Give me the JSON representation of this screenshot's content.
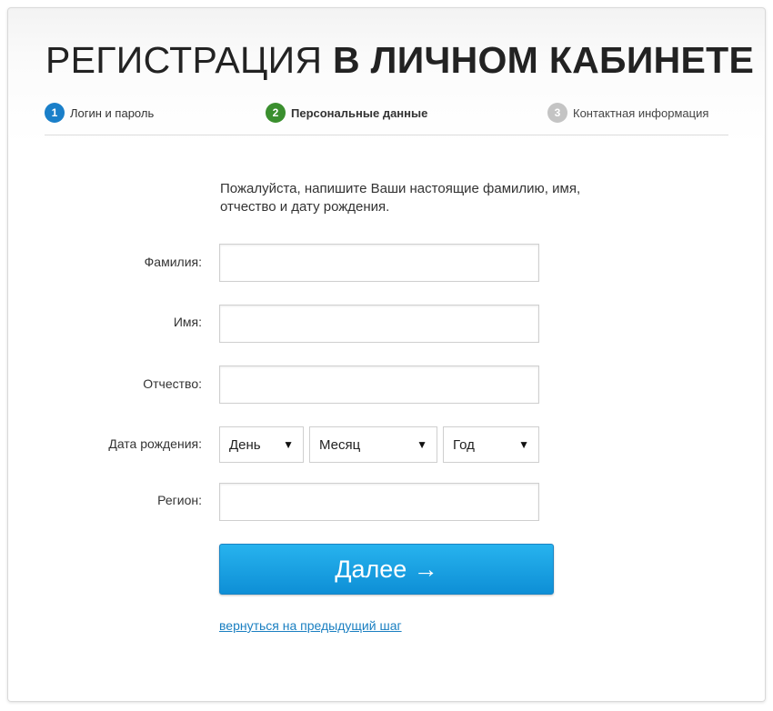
{
  "page": {
    "title_light": "РЕГИСТРАЦИЯ",
    "title_bold": "В ЛИЧНОМ КАБИНЕТЕ"
  },
  "steps": [
    {
      "number": "1",
      "label": "Логин и пароль",
      "color": "#1a7fc9",
      "state": "done"
    },
    {
      "number": "2",
      "label": "Персональные данные",
      "color": "#3a8f2e",
      "state": "current"
    },
    {
      "number": "3",
      "label": "Контактная информация",
      "color": "#c4c4c4",
      "state": "upcoming"
    }
  ],
  "form": {
    "intro": "Пожалуйста, напишите Ваши настоящие фамилию, имя, отчество и дату рождения.",
    "surname": {
      "label": "Фамилия:",
      "value": ""
    },
    "first_name": {
      "label": "Имя:",
      "value": ""
    },
    "patronymic": {
      "label": "Отчество:",
      "value": ""
    },
    "birth_date": {
      "label": "Дата рождения:",
      "day": "День",
      "month": "Месяц",
      "year": "Год"
    },
    "region": {
      "label": "Регион:",
      "value": ""
    },
    "next_button": "Далее →",
    "back_link": "вернуться на предыдущий шаг"
  },
  "icons": {
    "dropdown": "▼"
  }
}
